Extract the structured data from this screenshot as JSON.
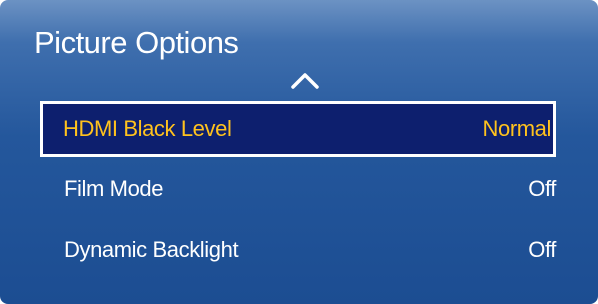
{
  "menu": {
    "title": "Picture Options",
    "items": [
      {
        "label": "HDMI Black Level",
        "value": "Normal",
        "selected": true
      },
      {
        "label": "Film Mode",
        "value": "Off",
        "selected": false
      },
      {
        "label": "Dynamic Backlight",
        "value": "Off",
        "selected": false
      }
    ]
  },
  "icons": {
    "scroll_up": "chevron-up-icon"
  },
  "colors": {
    "panel_top": "#6c92c3",
    "panel_bottom": "#1c4d92",
    "selected_bg": "#0d1f6e",
    "selected_text": "#ffc21e",
    "text": "#ffffff"
  }
}
